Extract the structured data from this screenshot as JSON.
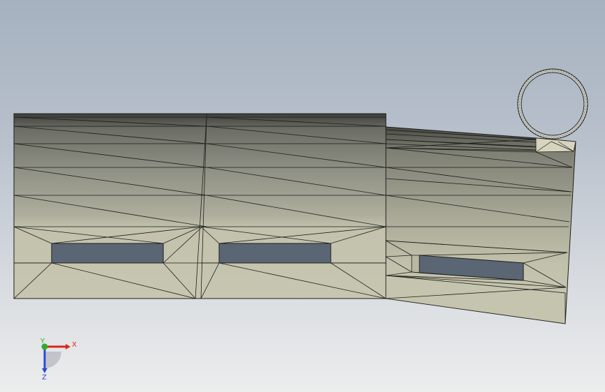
{
  "view": {
    "model": "tessellated-part",
    "ring_tab": "circular-ring"
  },
  "triad": {
    "x_label": "X",
    "y_label": "Y",
    "z_label": "Z",
    "x_color": "#d8271c",
    "y_color": "#2fae2d",
    "z_color": "#2d4bd1"
  },
  "colors": {
    "surface": "#c2c1ab",
    "edge": "#1d1d1b"
  }
}
